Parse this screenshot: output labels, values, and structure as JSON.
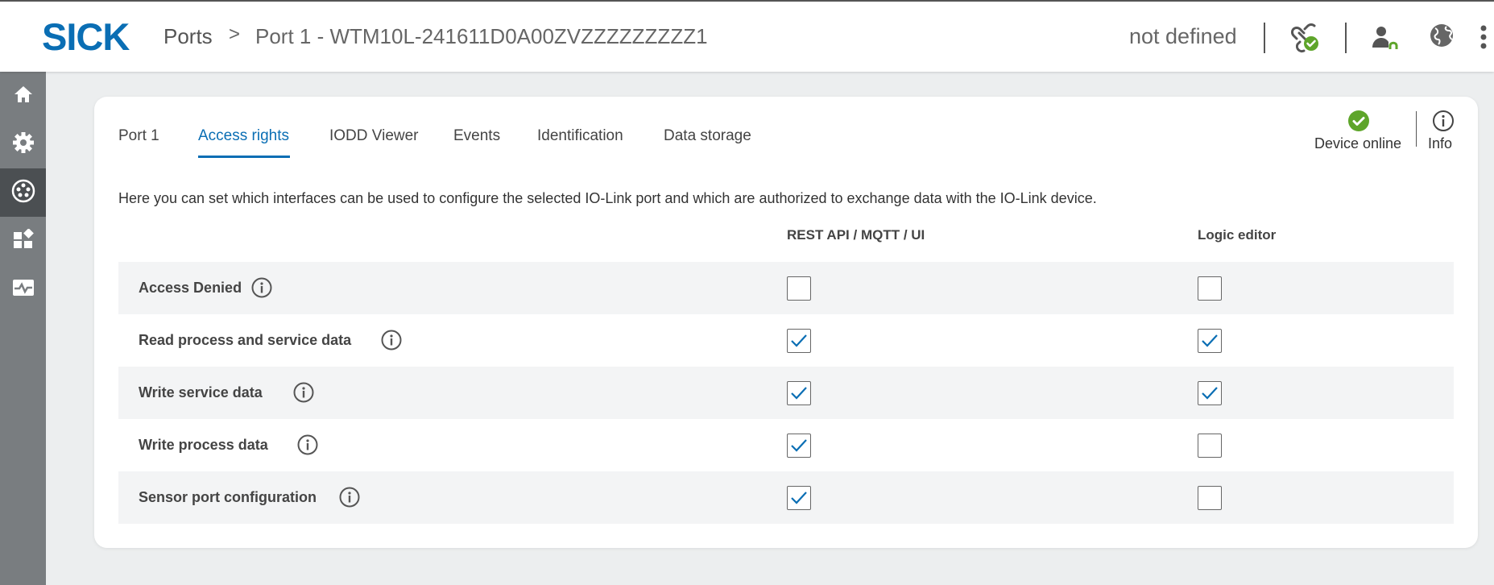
{
  "header": {
    "logo": "SICK",
    "breadcrumb": {
      "ports": "Ports",
      "separator": ">",
      "current": "Port 1 - WTM10L-241611D0A00ZVZZZZZZZZZ1"
    },
    "status": "not defined",
    "icons": [
      "link-status-icon",
      "user-icon",
      "globe-icon",
      "more-vertical-icon"
    ]
  },
  "sidebar": {
    "items": [
      {
        "icon": "home-icon"
      },
      {
        "icon": "gear-icon"
      },
      {
        "icon": "ports-connector-icon",
        "active": true
      },
      {
        "icon": "dashboard-icon"
      },
      {
        "icon": "monitor-icon"
      }
    ]
  },
  "tabs": [
    {
      "label": "Port 1"
    },
    {
      "label": "Access rights",
      "active": true
    },
    {
      "label": "IODD Viewer"
    },
    {
      "label": "Events"
    },
    {
      "label": "Identification"
    },
    {
      "label": "Data storage"
    }
  ],
  "device": {
    "status_label": "Device online",
    "info_label": "Info"
  },
  "description": "Here you can set which interfaces can be used to configure the selected IO-Link port and which are authorized to exchange data with the IO-Link device.",
  "table": {
    "columns": [
      "REST API / MQTT / UI",
      "Logic editor"
    ],
    "rows": [
      {
        "label": "Access Denied",
        "rest": false,
        "logic": false
      },
      {
        "label": "Read process and service data",
        "rest": true,
        "logic": true
      },
      {
        "label": "Write service data",
        "rest": true,
        "logic": true
      },
      {
        "label": "Write process data",
        "rest": true,
        "logic": false
      },
      {
        "label": "Sensor port configuration",
        "rest": true,
        "logic": false
      }
    ]
  },
  "colors": {
    "brand": "#0a6eb4",
    "online": "#5ea52a",
    "sidebar": "#797d80",
    "sidebar_active": "#4b4f52"
  }
}
